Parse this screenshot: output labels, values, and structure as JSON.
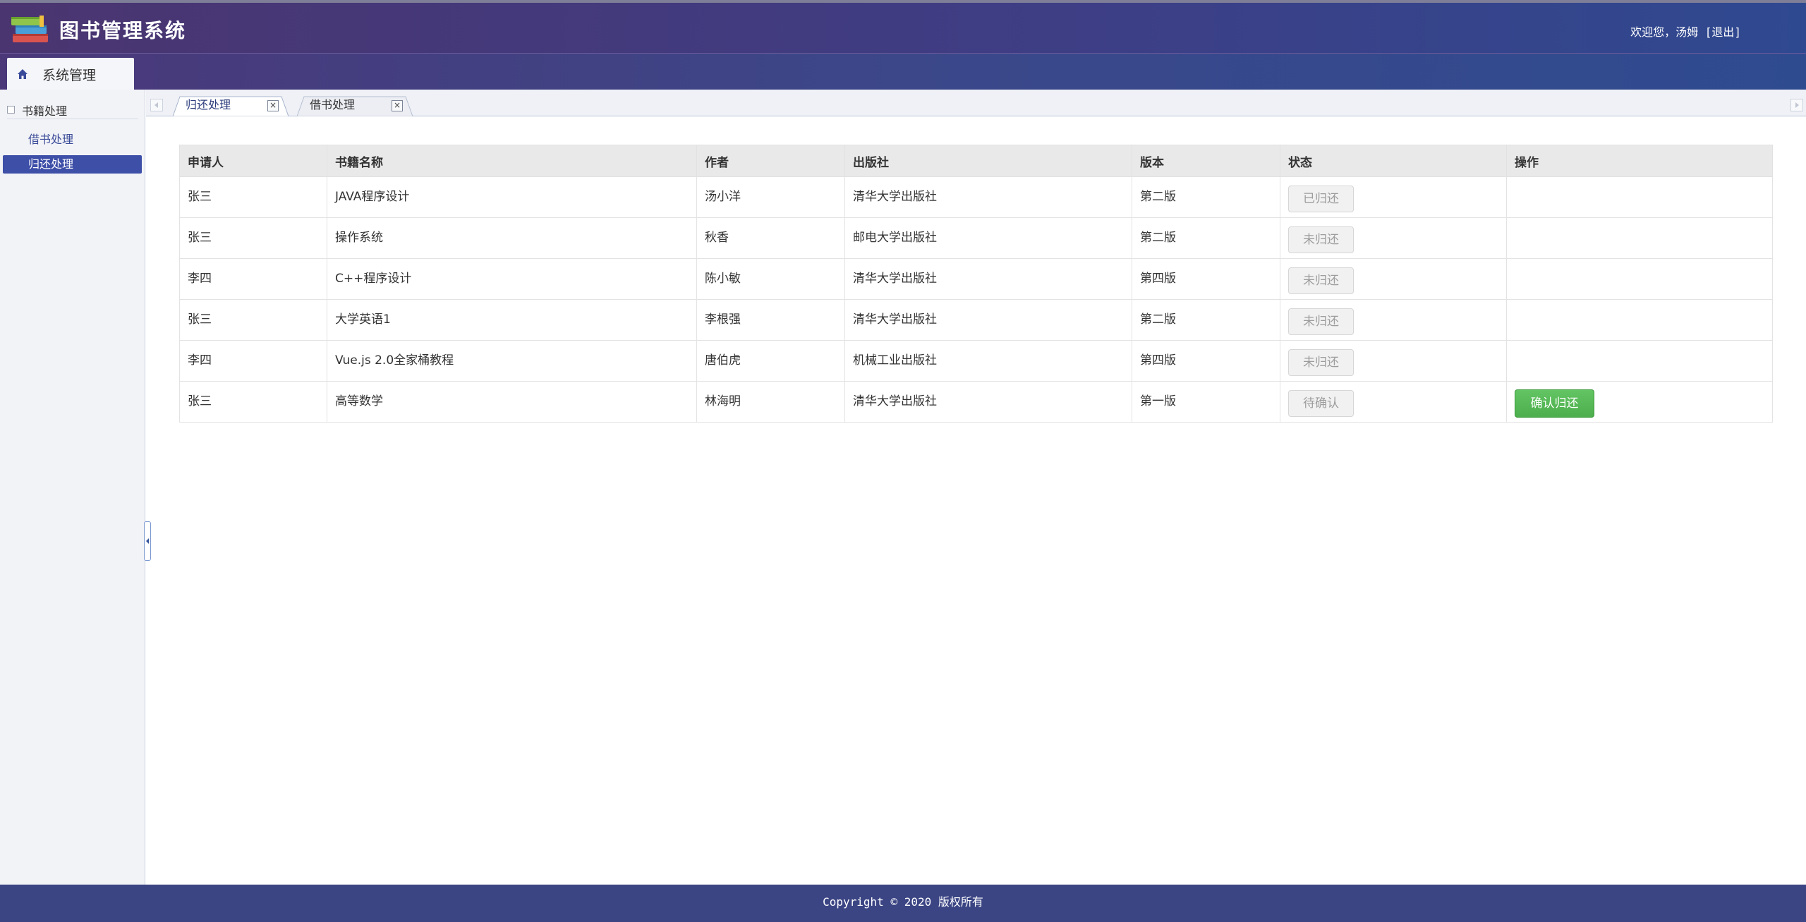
{
  "header": {
    "title": "图书管理系统",
    "welcome_prefix": "欢迎您，汤姆",
    "logout": "[退出]"
  },
  "nav": {
    "home_tab": "系统管理"
  },
  "sidebar": {
    "section": "书籍处理",
    "items": [
      {
        "label": "借书处理",
        "active": false
      },
      {
        "label": "归还处理",
        "active": true
      }
    ]
  },
  "tabs": [
    {
      "label": "归还处理",
      "active": true
    },
    {
      "label": "借书处理",
      "active": false
    }
  ],
  "table": {
    "columns": [
      "申请人",
      "书籍名称",
      "作者",
      "出版社",
      "版本",
      "状态",
      "操作"
    ],
    "rows": [
      {
        "applicant": "张三",
        "book": "JAVA程序设计",
        "author": "汤小洋",
        "publisher": "清华大学出版社",
        "edition": "第二版",
        "status": "已归还",
        "action": ""
      },
      {
        "applicant": "张三",
        "book": "操作系统",
        "author": "秋香",
        "publisher": "邮电大学出版社",
        "edition": "第二版",
        "status": "未归还",
        "action": ""
      },
      {
        "applicant": "李四",
        "book": "C++程序设计",
        "author": "陈小敏",
        "publisher": "清华大学出版社",
        "edition": "第四版",
        "status": "未归还",
        "action": ""
      },
      {
        "applicant": "张三",
        "book": "大学英语1",
        "author": "李根强",
        "publisher": "清华大学出版社",
        "edition": "第二版",
        "status": "未归还",
        "action": ""
      },
      {
        "applicant": "李四",
        "book": "Vue.js 2.0全家桶教程",
        "author": "唐伯虎",
        "publisher": "机械工业出版社",
        "edition": "第四版",
        "status": "未归还",
        "action": ""
      },
      {
        "applicant": "张三",
        "book": "高等数学",
        "author": "林海明",
        "publisher": "清华大学出版社",
        "edition": "第一版",
        "status": "待确认",
        "action": "确认归还"
      }
    ]
  },
  "footer": {
    "copyright": "Copyright © 2020 版权所有"
  },
  "colors": {
    "header_bg": "#3f3d84",
    "accent": "#3e4fa8",
    "confirm_button": "#5cb85c",
    "footer_bg": "#3b4584"
  }
}
